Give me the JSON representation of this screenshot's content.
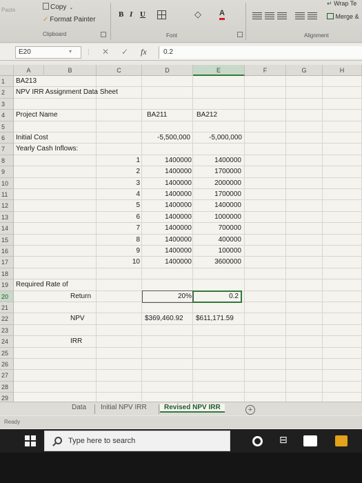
{
  "ribbon": {
    "paste_label": "Paste",
    "copy_label": "Copy",
    "format_painter_label": "Format Painter",
    "clipboard_group": "Clipboard",
    "bold": "B",
    "italic": "I",
    "underline": "U",
    "font_color_letter": "A",
    "font_group": "Font",
    "wrap_text_label": "Wrap Te",
    "merge_label": "Merge &",
    "alignment_group": "Alignment"
  },
  "formula_bar": {
    "name_box": "E20",
    "fx": "fx",
    "value": "0.2"
  },
  "columns": [
    "A",
    "B",
    "C",
    "D",
    "E",
    "F",
    "G",
    "H"
  ],
  "selected_column": "E",
  "rows": [
    "1",
    "2",
    "3",
    "4",
    "5",
    "6",
    "7",
    "8",
    "9",
    "10",
    "11",
    "12",
    "13",
    "14",
    "15",
    "16",
    "17",
    "18",
    "19",
    "20",
    "21",
    "22",
    "23",
    "24",
    "25",
    "26",
    "27",
    "28",
    "29"
  ],
  "selected_row": "20",
  "sheet": {
    "r1_a": "BA213",
    "r2_a": "NPV IRR Assignment Data Sheet",
    "r4_a": "Project Name",
    "r4_d": "BA211",
    "r4_e": "BA212",
    "r6_a": "Initial Cost",
    "r6_d": "-5,500,000",
    "r6_e": "-5,000,000",
    "r7_a": "Yearly Cash Inflows:",
    "years": [
      "1",
      "2",
      "3",
      "4",
      "5",
      "6",
      "7",
      "8",
      "9",
      "10"
    ],
    "ba211_inflows": [
      "1400000",
      "1400000",
      "1400000",
      "1400000",
      "1400000",
      "1400000",
      "1400000",
      "1400000",
      "1400000",
      "1400000"
    ],
    "ba212_inflows": [
      "1400000",
      "1700000",
      "2000000",
      "1700000",
      "1400000",
      "1000000",
      "700000",
      "400000",
      "100000",
      "3600000"
    ],
    "r19_a": "Required Rate of",
    "r20_b": "Return",
    "r20_d": "20%",
    "r20_e": "0.2",
    "r22_b": "NPV",
    "r22_d": "$369,460.92",
    "r22_e": "$611,171.59",
    "r24_b": "IRR"
  },
  "tabs": {
    "data": "Data",
    "initial": "Initial NPV IRR",
    "revised": "Revised NPV IRR"
  },
  "status": "Ready",
  "taskbar": {
    "search_placeholder": "Type here to search"
  }
}
